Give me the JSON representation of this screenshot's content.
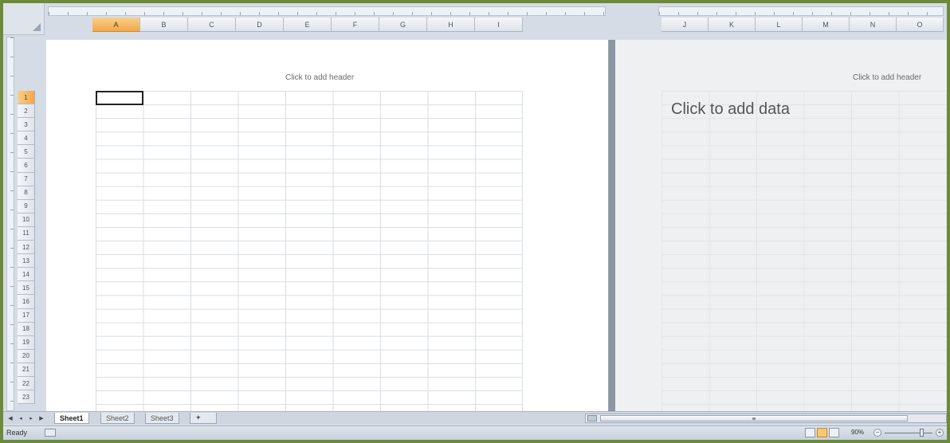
{
  "columns_left": [
    "A",
    "B",
    "C",
    "D",
    "E",
    "F",
    "G",
    "H",
    "I"
  ],
  "columns_right": [
    "J",
    "K",
    "L",
    "M",
    "N",
    "O"
  ],
  "active_column": "A",
  "rows": [
    "1",
    "2",
    "3",
    "4",
    "5",
    "6",
    "7",
    "8",
    "9",
    "10",
    "11",
    "12",
    "13",
    "14",
    "15",
    "16",
    "17",
    "18",
    "19",
    "20",
    "21",
    "22",
    "23"
  ],
  "active_row": "1",
  "page_left": {
    "header_hint": "Click to add header"
  },
  "page_right": {
    "header_hint": "Click to add header",
    "data_hint": "Click to add data"
  },
  "sheet_tabs": [
    "Sheet1",
    "Sheet2",
    "Sheet3"
  ],
  "active_sheet": "Sheet1",
  "status": {
    "text": "Ready",
    "zoom": "90%"
  },
  "colors": {
    "active_header": "#f2a84a",
    "frame": "#6b8a3a"
  }
}
